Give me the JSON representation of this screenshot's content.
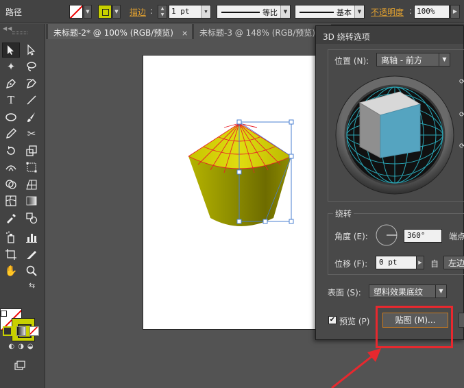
{
  "control_bar": {
    "object_type": "路径",
    "stroke_label": "描边",
    "stroke_weight": "1 pt",
    "variable_width_label": "等比",
    "brush_label": "基本",
    "opacity_label": "不透明度",
    "opacity_value": "100%"
  },
  "tabs": [
    {
      "label": "未标题-2* @ 100% (RGB/预览)",
      "close": "×"
    },
    {
      "label": "未标题-3 @ 148% (RGB/预览)",
      "close": "×"
    }
  ],
  "dialog": {
    "title": "3D 绕转选项",
    "position_label": "位置 (N):",
    "position_value": "离轴 - 前方",
    "revolve_label": "绕转",
    "angle_label": "角度 (E):",
    "angle_value": "360°",
    "cap_label": "端点",
    "offset_label": "位移 (F):",
    "offset_value": "0 pt",
    "from_label": "自",
    "from_value": "左边",
    "surface_label": "表面 (S):",
    "surface_value": "塑料效果底纹",
    "preview_label": "预览 (P)",
    "preview_checked": "✔",
    "map_art_button": "贴图 (M)..."
  },
  "colors": {
    "accent_orange": "#e0a030",
    "fill_color": "#c8d000",
    "annotation_red": "#e8282e"
  }
}
